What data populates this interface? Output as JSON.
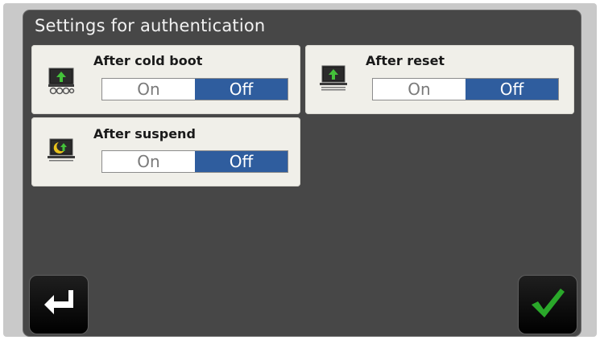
{
  "title": "Settings for authentication",
  "options": [
    {
      "label": "After cold boot",
      "on_label": "On",
      "off_label": "Off",
      "selected": "Off",
      "icon": "cold-boot-icon"
    },
    {
      "label": "After reset",
      "on_label": "On",
      "off_label": "Off",
      "selected": "Off",
      "icon": "reset-icon"
    },
    {
      "label": "After suspend",
      "on_label": "On",
      "off_label": "Off",
      "selected": "Off",
      "icon": "suspend-icon"
    }
  ],
  "buttons": {
    "back_icon": "enter-arrow-icon",
    "confirm_icon": "checkmark-icon"
  },
  "colors": {
    "selected": "#2f5d9e",
    "background": "#474747",
    "panel": "#f0efe9",
    "confirm": "#2aa82a"
  }
}
